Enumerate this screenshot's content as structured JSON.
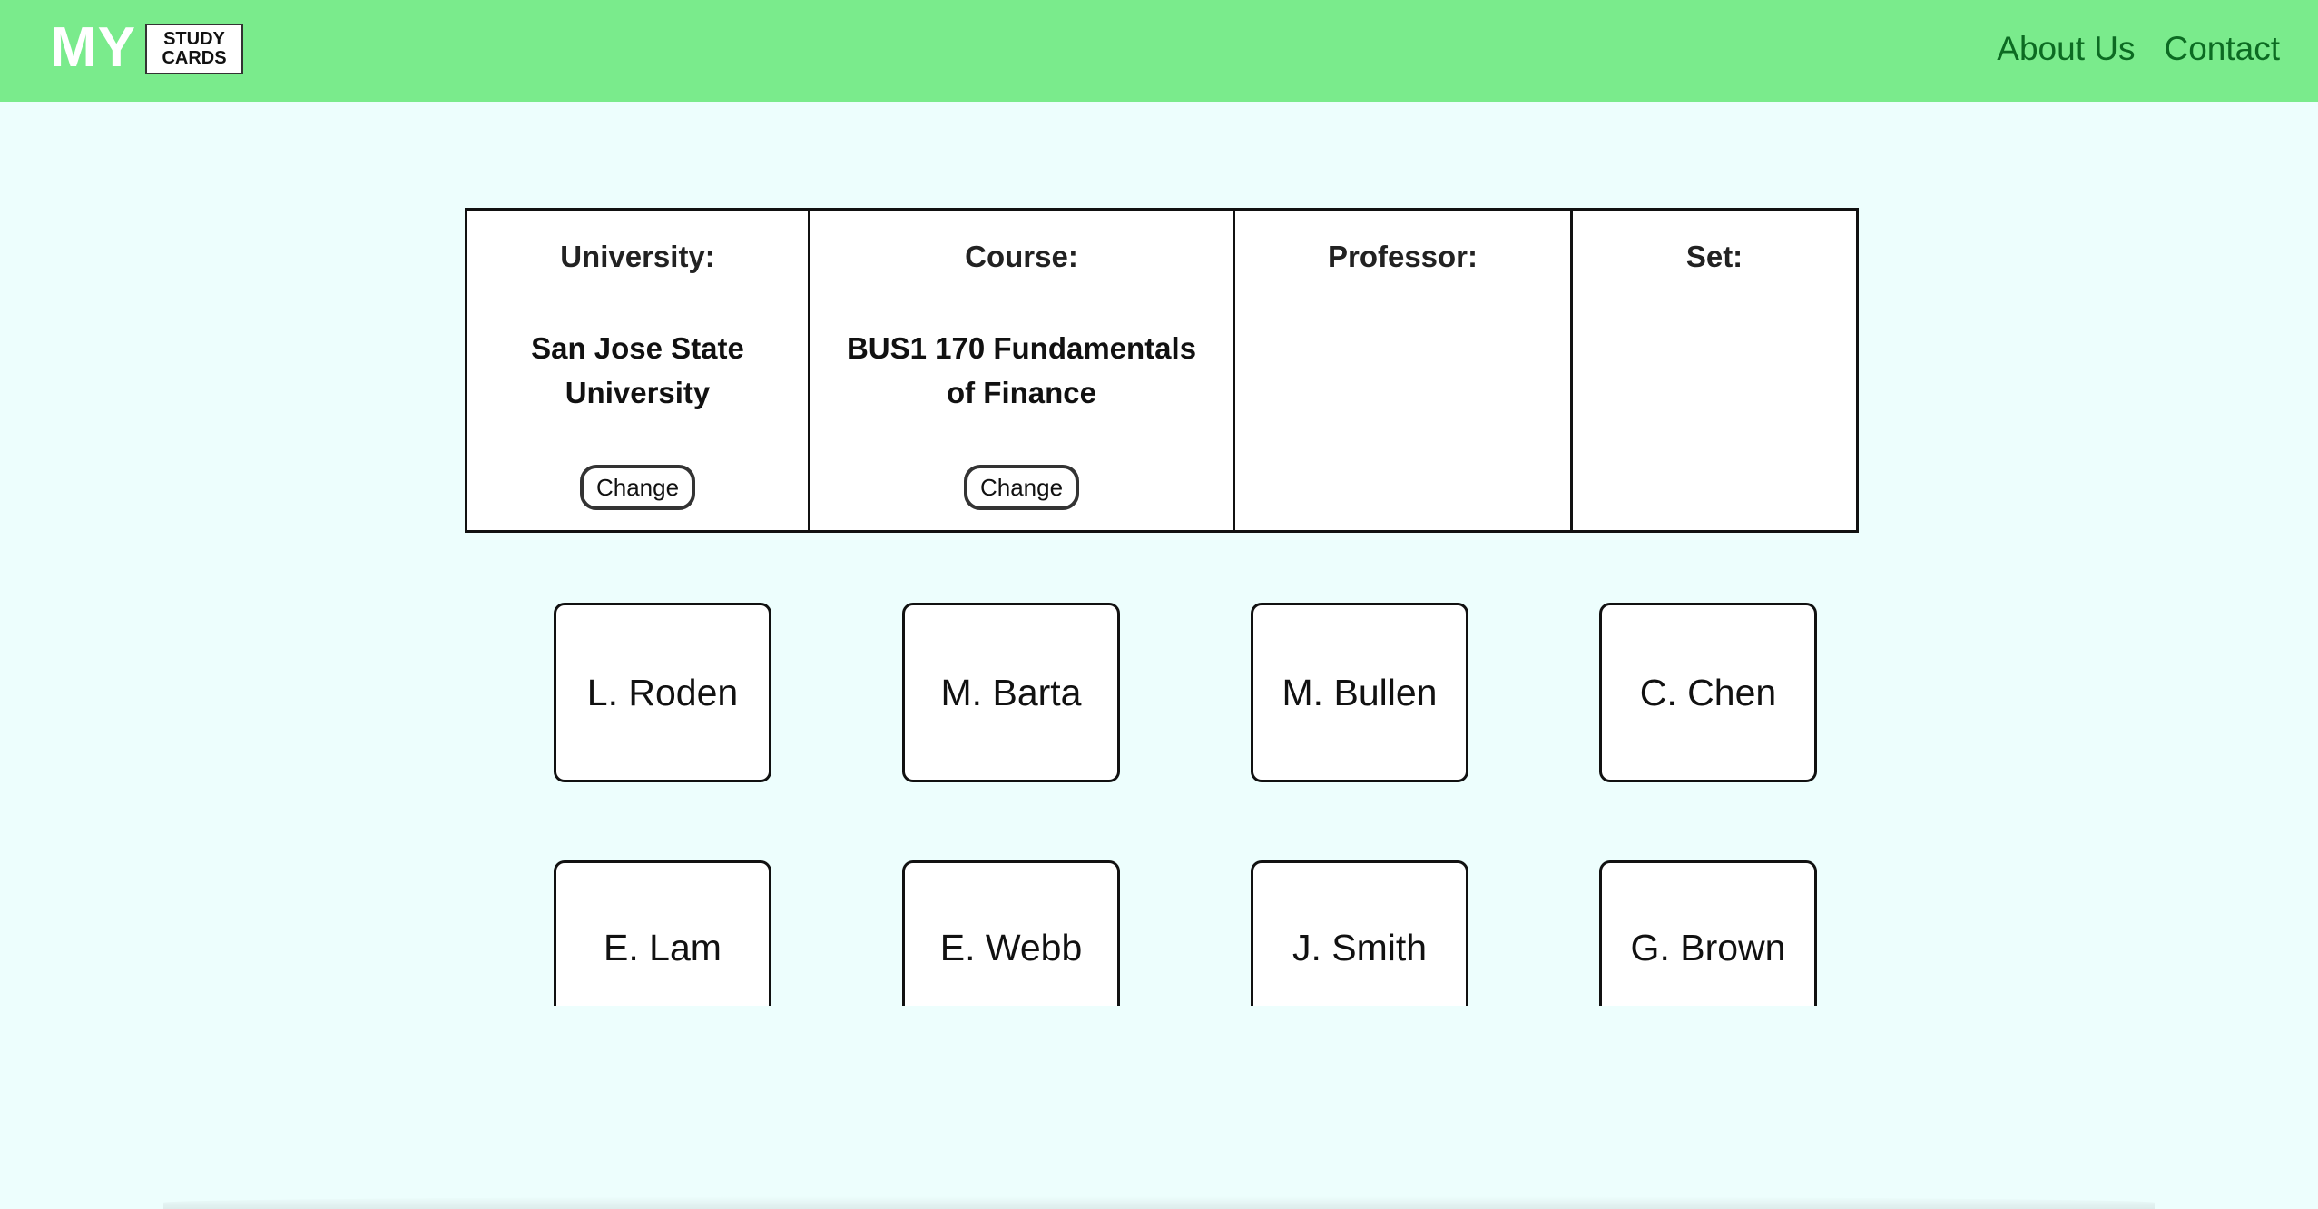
{
  "header": {
    "logo_big": "MY",
    "logo_small_line1": "STUDY",
    "logo_small_line2": "CARDS",
    "nav": {
      "about": "About Us",
      "contact": "Contact"
    }
  },
  "info": {
    "university_label": "University:",
    "university_value": "San Jose State University",
    "course_label": "Course:",
    "course_value": "BUS1 170 Fundamentals of Finance",
    "professor_label": "Professor:",
    "set_label": "Set:",
    "change_label": "Change"
  },
  "professors": [
    "L. Roden",
    "M. Barta",
    "M. Bullen",
    "C. Chen",
    "E. Lam",
    "E. Webb",
    "J. Smith",
    "G. Brown"
  ],
  "colors": {
    "header_bg": "#7aeb8c",
    "page_bg": "#edfefd",
    "nav_link": "#0c6b22"
  }
}
